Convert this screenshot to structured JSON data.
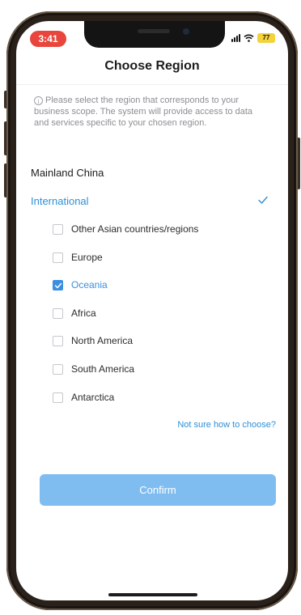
{
  "status_bar": {
    "time": "3:41",
    "battery": "77",
    "time_pill_color": "#e8453c",
    "battery_color": "#f3d23a"
  },
  "header": {
    "title": "Choose Region"
  },
  "notice": {
    "icon": "info-icon",
    "text": "Please select the region that corresponds to your business scope. The system will provide access to data and services specific to your chosen region."
  },
  "regions": [
    {
      "label": "Mainland China",
      "selected": false
    },
    {
      "label": "International",
      "selected": true,
      "icon": "checkmark-icon"
    }
  ],
  "sub_regions": [
    {
      "label": "Other Asian countries/regions",
      "checked": false
    },
    {
      "label": "Europe",
      "checked": false
    },
    {
      "label": "Oceania",
      "checked": true
    },
    {
      "label": "Africa",
      "checked": false
    },
    {
      "label": "North America",
      "checked": false
    },
    {
      "label": "South America",
      "checked": false
    },
    {
      "label": "Antarctica",
      "checked": false
    }
  ],
  "help_link": "Not sure how to choose?",
  "confirm_button": "Confirm",
  "colors": {
    "accent": "#2f8fd6",
    "checkbox_checked": "#3b8fe0",
    "confirm_bg": "#7fbdf0"
  }
}
